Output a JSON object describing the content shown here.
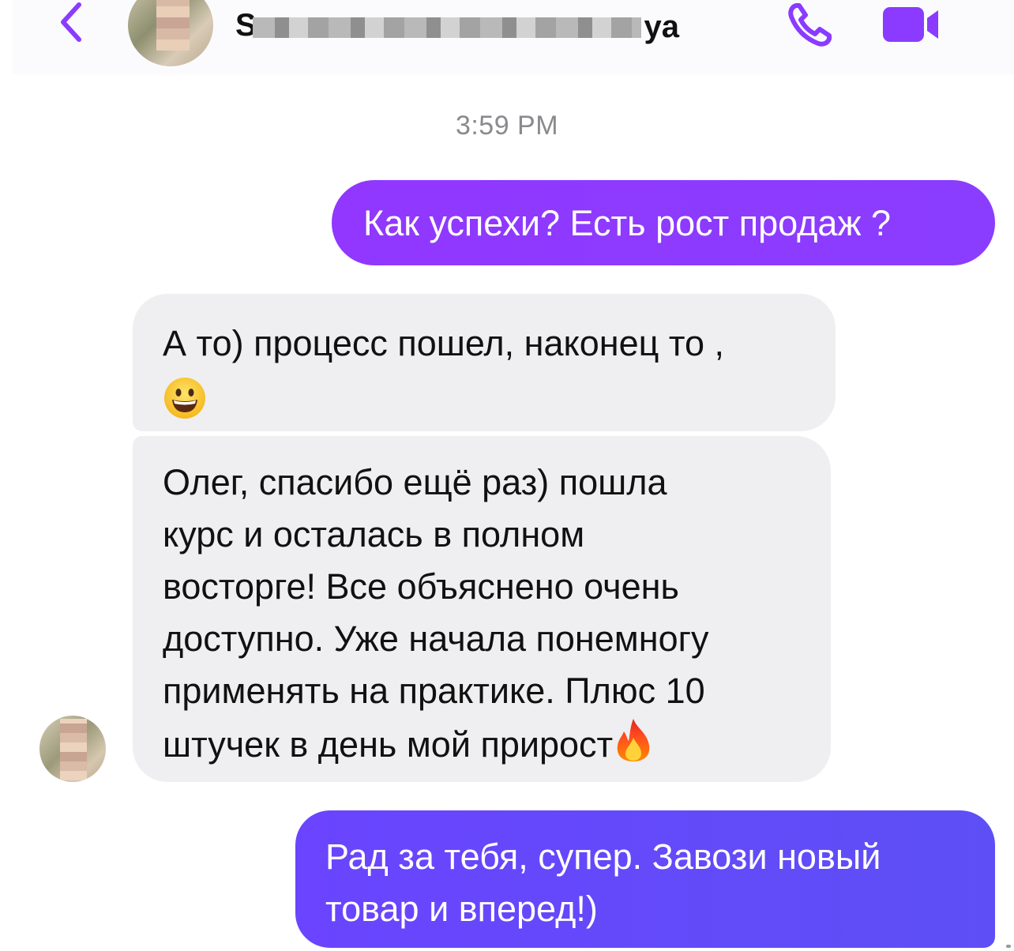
{
  "header": {
    "contact_name_visible_tail": "ya",
    "contact_name_first_letter": "S"
  },
  "thread": {
    "timestamp": "3:59 PM",
    "messages": [
      {
        "direction": "outgoing",
        "lines": [
          "Как успехи? Есть рост продаж ?"
        ]
      },
      {
        "direction": "incoming",
        "lines": [
          "А то) процесс пошел, наконец то ,"
        ],
        "emoji": "grinning-face"
      },
      {
        "direction": "incoming",
        "lines": [
          "Олег, спасибо ещё раз) пошла",
          "курс и осталась в полном",
          "восторге! Все объяснено очень",
          "доступно. Уже начала понемногу",
          "применять на практике. Плюс 10",
          "штучек  в день мой прирост"
        ],
        "emoji": "fire"
      },
      {
        "direction": "outgoing",
        "lines": [
          "Рад за тебя, супер. Завози новый",
          "товар и вперед!)"
        ]
      }
    ]
  },
  "colors": {
    "accent": "#8a3bff",
    "outgoing_bubble_1": "#9137ff",
    "outgoing_bubble_2": "#6a44ff",
    "incoming_bubble": "#efeff1",
    "timestamp_text": "#8a8a8e"
  },
  "icons": {
    "back": "chevron-left-icon",
    "call": "phone-icon",
    "video": "video-camera-icon"
  }
}
